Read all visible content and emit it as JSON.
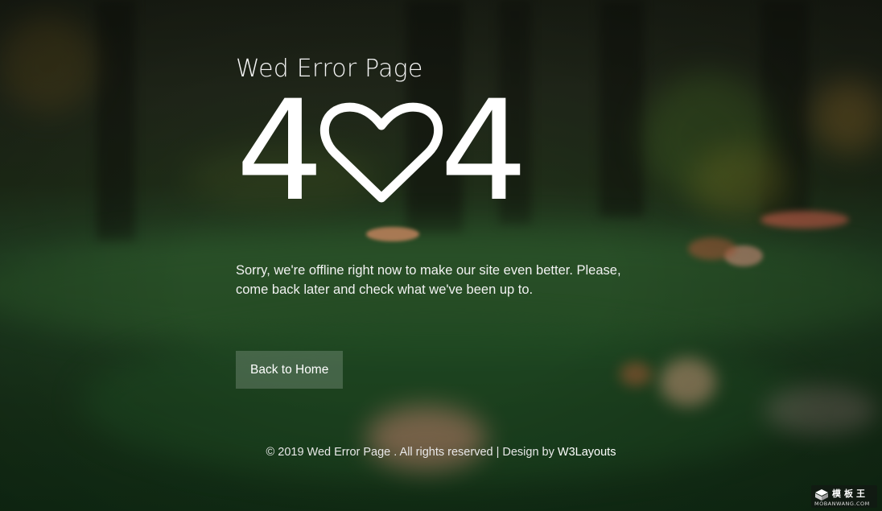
{
  "page": {
    "subtitle": "Wed Error Page",
    "code_left": "4",
    "code_right": "4",
    "code_middle_icon": "heart-outline-icon",
    "message_line1": "Sorry, we're offline right now to make our site even better. Please,",
    "message_line2": "come back later and check what we've been up to.",
    "button_label": "Back to Home"
  },
  "footer": {
    "text": "© 2019 Wed Error Page . All rights reserved | Design by ",
    "brand": "W3Layouts"
  },
  "watermark": {
    "title": "模板王",
    "url": "MOBANWANG.COM"
  },
  "colors": {
    "text": "#ffffff",
    "button_bg": "rgba(255,255,255,0.18)",
    "background": "#1b2a18"
  }
}
